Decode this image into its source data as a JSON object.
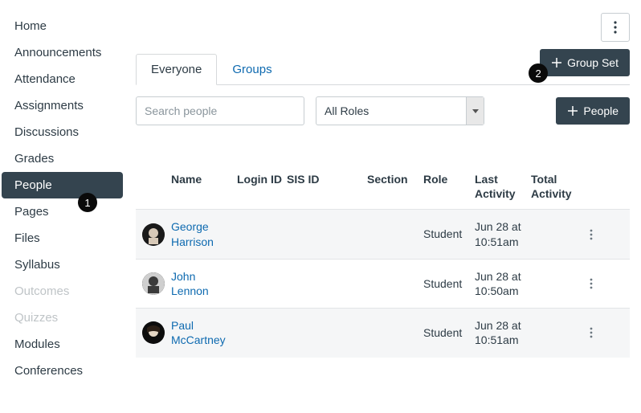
{
  "sidebar": {
    "items": [
      {
        "label": "Home",
        "state": "normal"
      },
      {
        "label": "Announcements",
        "state": "normal"
      },
      {
        "label": "Attendance",
        "state": "normal"
      },
      {
        "label": "Assignments",
        "state": "normal"
      },
      {
        "label": "Discussions",
        "state": "normal"
      },
      {
        "label": "Grades",
        "state": "normal"
      },
      {
        "label": "People",
        "state": "active",
        "badge": "1"
      },
      {
        "label": "Pages",
        "state": "normal"
      },
      {
        "label": "Files",
        "state": "normal"
      },
      {
        "label": "Syllabus",
        "state": "normal"
      },
      {
        "label": "Outcomes",
        "state": "disabled"
      },
      {
        "label": "Quizzes",
        "state": "disabled"
      },
      {
        "label": "Modules",
        "state": "normal"
      },
      {
        "label": "Conferences",
        "state": "normal"
      }
    ]
  },
  "tabs": {
    "everyone": "Everyone",
    "groups": "Groups"
  },
  "buttons": {
    "group_set": "Group Set",
    "people": "People",
    "group_set_badge": "2"
  },
  "filters": {
    "search_placeholder": "Search people",
    "role_selected": "All Roles"
  },
  "table": {
    "headers": {
      "name": "Name",
      "login_id": "Login ID",
      "sis_id": "SIS ID",
      "section": "Section",
      "role": "Role",
      "last_activity": "Last Activity",
      "total_activity": "Total Activity"
    },
    "rows": [
      {
        "name": "George Harrison",
        "login_id": "",
        "sis_id": "",
        "section": "",
        "role": "Student",
        "last_activity": "Jun 28 at 10:51am",
        "total_activity": "",
        "shaded": true
      },
      {
        "name": "John Lennon",
        "login_id": "",
        "sis_id": "",
        "section": "",
        "role": "Student",
        "last_activity": "Jun 28 at 10:50am",
        "total_activity": "",
        "shaded": false
      },
      {
        "name": "Paul McCartney",
        "login_id": "",
        "sis_id": "",
        "section": "",
        "role": "Student",
        "last_activity": "Jun 28 at 10:51am",
        "total_activity": "",
        "shaded": true
      }
    ]
  }
}
